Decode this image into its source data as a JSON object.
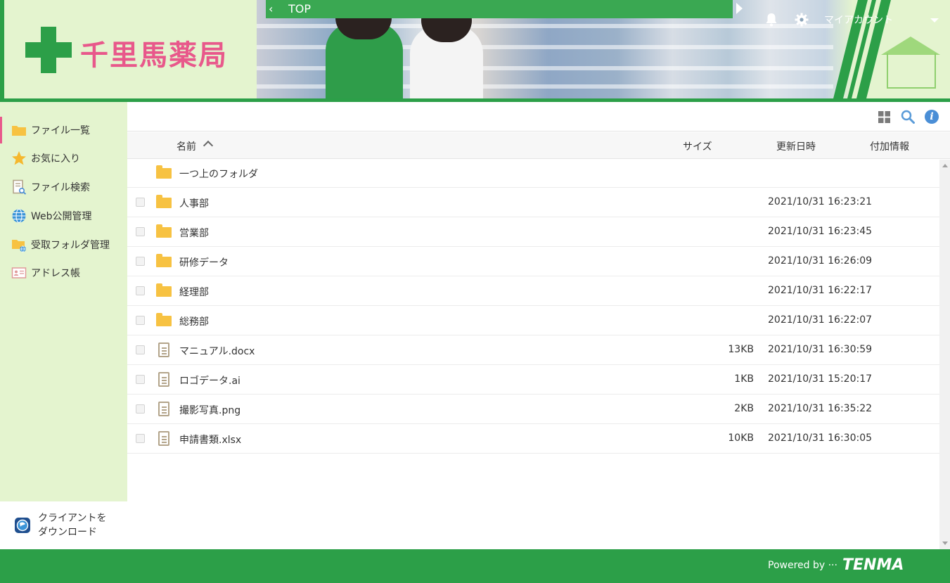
{
  "header": {
    "logo_text": "千里馬薬局",
    "topbar_label": "TOP",
    "account_label": "マイアカウント"
  },
  "sidebar": {
    "items": [
      {
        "label": "ファイル一覧",
        "icon": "folder-icon"
      },
      {
        "label": "お気に入り",
        "icon": "star-icon"
      },
      {
        "label": "ファイル検索",
        "icon": "file-search-icon"
      },
      {
        "label": "Web公開管理",
        "icon": "globe-icon"
      },
      {
        "label": "受取フォルダ管理",
        "icon": "receive-folder-icon"
      },
      {
        "label": "アドレス帳",
        "icon": "address-book-icon"
      }
    ],
    "download": {
      "line1": "クライアントを",
      "line2": "ダウンロード"
    }
  },
  "list": {
    "columns": {
      "name": "名前",
      "size": "サイズ",
      "modified": "更新日時",
      "extra": "付加情報"
    },
    "parent_label": "一つ上のフォルダ",
    "rows": [
      {
        "type": "folder",
        "name": "人事部",
        "size": "",
        "modified": "2021/10/31 16:23:21"
      },
      {
        "type": "folder",
        "name": "営業部",
        "size": "",
        "modified": "2021/10/31 16:23:45"
      },
      {
        "type": "folder",
        "name": "研修データ",
        "size": "",
        "modified": "2021/10/31 16:26:09"
      },
      {
        "type": "folder",
        "name": "経理部",
        "size": "",
        "modified": "2021/10/31 16:22:17"
      },
      {
        "type": "folder",
        "name": "総務部",
        "size": "",
        "modified": "2021/10/31 16:22:07"
      },
      {
        "type": "file",
        "name": "マニュアル.docx",
        "size": "13KB",
        "modified": "2021/10/31 16:30:59"
      },
      {
        "type": "file",
        "name": "ロゴデータ.ai",
        "size": "1KB",
        "modified": "2021/10/31 15:20:17"
      },
      {
        "type": "file",
        "name": "撮影写真.png",
        "size": "2KB",
        "modified": "2021/10/31 16:35:22"
      },
      {
        "type": "file",
        "name": "申請書類.xlsx",
        "size": "10KB",
        "modified": "2021/10/31 16:30:05"
      }
    ]
  },
  "footer": {
    "powered_by": "Powered by ···",
    "brand": "TENMA"
  },
  "colors": {
    "brand_green": "#2c9f48",
    "sidebar_bg": "#e4f4cf",
    "logo_pink": "#e8588b",
    "folder_yellow": "#f7c242"
  }
}
